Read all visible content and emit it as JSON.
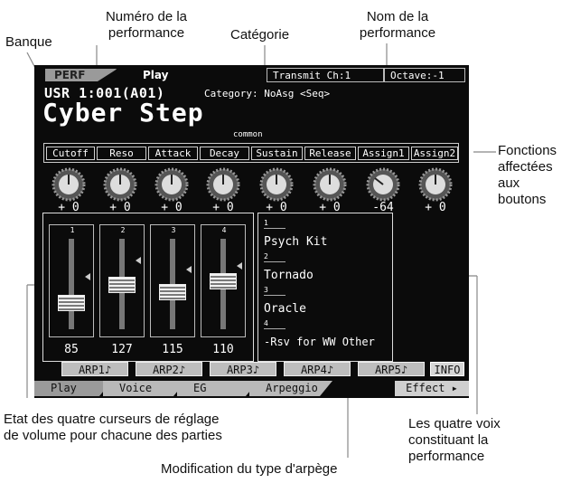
{
  "annotations": {
    "banque": "Banque",
    "numero_line1": "Numéro de la",
    "numero_line2": "performance",
    "categorie": "Catégorie",
    "nom_line1": "Nom de la",
    "nom_line2": "performance",
    "fonctions_line1": "Fonctions",
    "fonctions_line2": "affectées",
    "fonctions_line3": "aux",
    "fonctions_line4": "boutons",
    "etat_line1": "Etat des quatre curseurs de réglage",
    "etat_line2": "de volume pour chacune des parties",
    "voix_line1": "Les quatre voix",
    "voix_line2": "constituant la",
    "voix_line3": "performance",
    "arpege": "Modification du type d'arpège"
  },
  "screen": {
    "mode_tab": "PERF",
    "page_tab": "Play",
    "transmit": "Transmit Ch:1",
    "octave": "Octave:-1",
    "perf_number": "USR 1:001(A01)",
    "category": "Category: NoAsg <Seq>",
    "perf_name": "Cyber Step",
    "common_label": "common",
    "knobs": [
      {
        "label": "Cutoff",
        "value": "+ 0"
      },
      {
        "label": "Reso",
        "value": "+ 0"
      },
      {
        "label": "Attack",
        "value": "+ 0"
      },
      {
        "label": "Decay",
        "value": "+ 0"
      },
      {
        "label": "Sustain",
        "value": "+ 0"
      },
      {
        "label": "Release",
        "value": "+ 0"
      },
      {
        "label": "Assign1",
        "value": "-64"
      },
      {
        "label": "Assign2",
        "value": "+ 0"
      }
    ],
    "sliders": [
      {
        "num": "1",
        "value": "85"
      },
      {
        "num": "2",
        "value": "127"
      },
      {
        "num": "3",
        "value": "115"
      },
      {
        "num": "4",
        "value": "110"
      }
    ],
    "voices": [
      {
        "num": "1",
        "name": "Psych Kit"
      },
      {
        "num": "2",
        "name": "Tornado"
      },
      {
        "num": "3",
        "name": "Oracle"
      },
      {
        "num": "4",
        "name": "-Rsv for WW Other"
      }
    ],
    "arp_buttons": [
      "ARP1♪",
      "ARP2♪",
      "ARP3♪",
      "ARP4♪",
      "ARP5♪"
    ],
    "info_button": "INFO",
    "bottom_tabs": [
      "Play",
      "Voice",
      "EG",
      "Arpeggio"
    ],
    "effect_tab": "Effect ▸"
  }
}
